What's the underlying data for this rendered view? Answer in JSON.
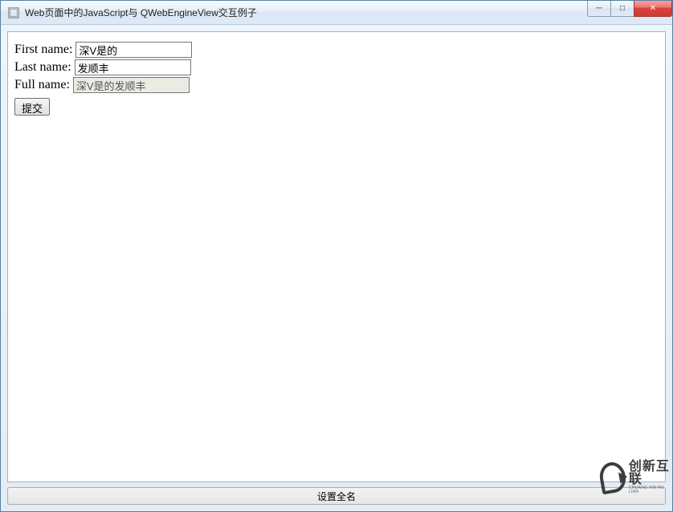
{
  "window": {
    "title": "Web页面中的JavaScript与 QWebEngineView交互例子"
  },
  "controls": {
    "minimize_glyph": "─",
    "maximize_glyph": "□",
    "close_glyph": "✕"
  },
  "form": {
    "first_name_label": "First name:",
    "first_name_value": "深V是的",
    "last_name_label": "Last name:",
    "last_name_value": "发顺丰",
    "full_name_label": "Full name:",
    "full_name_value": "深V是的发顺丰",
    "submit_label": "提交"
  },
  "bottom_button": {
    "label": "设置全名"
  },
  "watermark": {
    "brand_cn": "创新互联",
    "brand_en": "CHUANG XIN HU LIAN"
  }
}
